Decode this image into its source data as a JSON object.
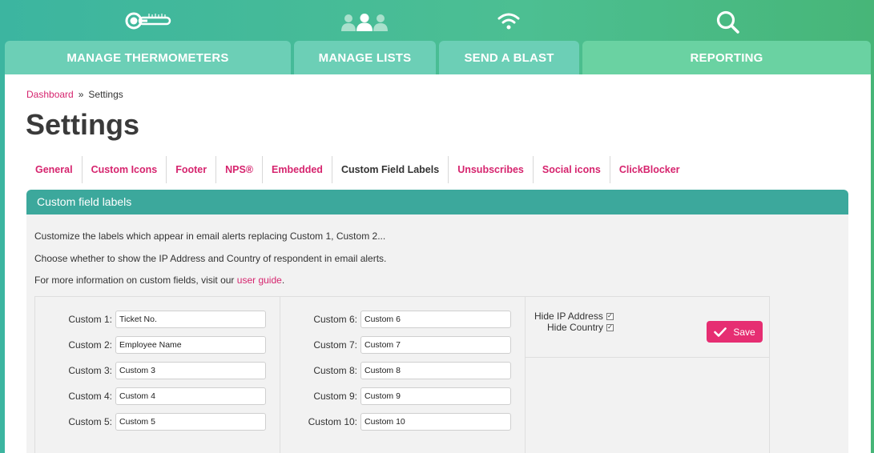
{
  "nav": {
    "icons": [
      "thermometer-icon",
      "users-icon",
      "wifi-icon",
      "search-icon"
    ],
    "tabs": [
      "MANAGE THERMOMETERS",
      "MANAGE LISTS",
      "SEND A BLAST",
      "REPORTING"
    ]
  },
  "breadcrumb": {
    "link": "Dashboard",
    "separator": "»",
    "current": "Settings"
  },
  "page_title": "Settings",
  "subtabs": [
    {
      "label": "General"
    },
    {
      "label": "Custom Icons"
    },
    {
      "label": "Footer"
    },
    {
      "label": "NPS®"
    },
    {
      "label": "Embedded"
    },
    {
      "label": "Custom Field Labels",
      "active": true
    },
    {
      "label": "Unsubscribes"
    },
    {
      "label": "Social icons"
    },
    {
      "label": "ClickBlocker"
    }
  ],
  "card": {
    "title": "Custom field labels",
    "line1": "Customize the labels which appear in email alerts replacing Custom 1, Custom 2...",
    "line2": "Choose whether to show the IP Address and Country of respondent in email alerts.",
    "line3_prefix": "For more information on custom fields, visit our ",
    "line3_link": "user guide",
    "line3_suffix": "."
  },
  "fields": [
    {
      "label": "Custom 1:",
      "value": "Ticket No."
    },
    {
      "label": "Custom 2:",
      "value": "Employee Name"
    },
    {
      "label": "Custom 3:",
      "value": "Custom 3"
    },
    {
      "label": "Custom 4:",
      "value": "Custom 4"
    },
    {
      "label": "Custom 5:",
      "value": "Custom 5"
    },
    {
      "label": "Custom 6:",
      "value": "Custom 6"
    },
    {
      "label": "Custom 7:",
      "value": "Custom 7"
    },
    {
      "label": "Custom 8:",
      "value": "Custom 8"
    },
    {
      "label": "Custom 9:",
      "value": "Custom 9"
    },
    {
      "label": "Custom 10:",
      "value": "Custom 10"
    }
  ],
  "options": {
    "hide_ip_label": "Hide IP Address",
    "hide_ip_checked": true,
    "hide_country_label": "Hide Country",
    "hide_country_checked": true,
    "save_label": "Save"
  },
  "colors": {
    "accent": "#d6246e",
    "save": "#e62e72",
    "card_header": "#3ca89c",
    "nav_tab": "#6ccfb6"
  }
}
